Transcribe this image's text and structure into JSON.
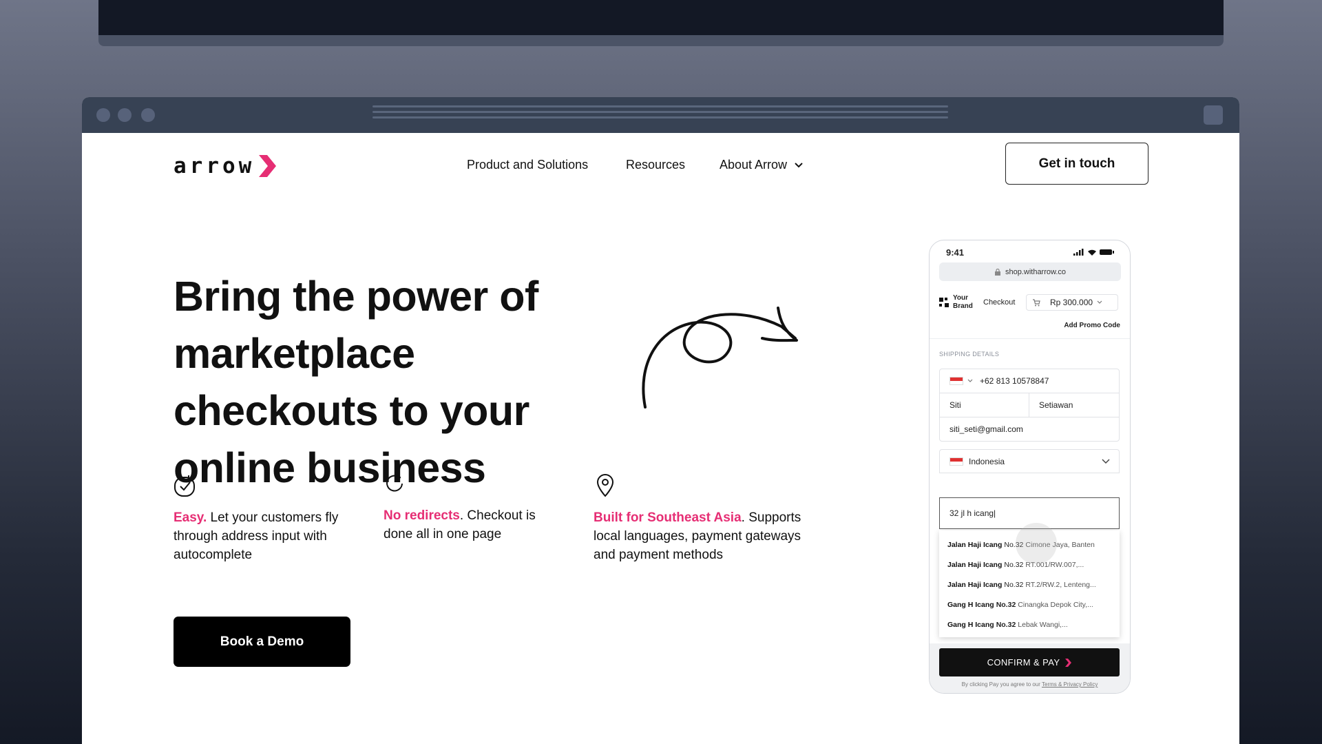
{
  "brand": {
    "logo_text": "arrow",
    "accent": "#e62e74"
  },
  "nav": {
    "items": [
      {
        "label": "Product and Solutions"
      },
      {
        "label": "Resources"
      },
      {
        "label": "About Arrow"
      }
    ],
    "cta_label": "Get in touch"
  },
  "hero": {
    "lines": [
      "Bring the power of",
      "marketplace",
      "checkouts to your",
      "online business"
    ]
  },
  "features": [
    {
      "icon": "check-circle-icon",
      "highlight": "Easy.",
      "text": " Let your customers fly through address input with autocomplete"
    },
    {
      "icon": "refresh-icon",
      "highlight": "No redirects",
      "text": ". Checkout is done all in one page"
    },
    {
      "icon": "location-pin-icon",
      "highlight": "Built for Southeast Asia",
      "text": ". Supports local languages, payment gateways and payment methods"
    }
  ],
  "demo_label": "Book a Demo",
  "phone": {
    "time": "9:41",
    "url": "shop.witharrow.co",
    "brand_line1": "Your",
    "brand_line2": "Brand",
    "checkout_label": "Checkout",
    "price": "Rp 300.000",
    "promo": "Add Promo Code",
    "shipping_label": "SHIPPING DETAILS",
    "phone_number": "+62 813 10578847",
    "first_name": "Siti",
    "last_name": "Setiawan",
    "email": "siti_seti@gmail.com",
    "country": "Indonesia",
    "address_input": "32 jl h icang|",
    "suggestions": [
      {
        "bold": "Jalan Haji Icang",
        "num": "No.32",
        "rest": "Cimone Jaya, Banten"
      },
      {
        "bold": "Jalan Haji Icang",
        "num": "No.32",
        "rest": "RT.001/RW.007,..."
      },
      {
        "bold": "Jalan Haji Icang",
        "num": "No.32",
        "rest": "RT.2/RW.2, Lenteng..."
      },
      {
        "bold": "Gang H Icang",
        "num": "No.32",
        "rest": "Cinangka Depok City,..."
      },
      {
        "bold": "Gang H Icang",
        "num": "No.32",
        "rest": "Lebak Wangi,..."
      }
    ],
    "confirm_label": "CONFIRM & PAY",
    "terms_prefix": "By clicking Pay you agree to our ",
    "terms_link": "Terms & Privacy Policy"
  }
}
